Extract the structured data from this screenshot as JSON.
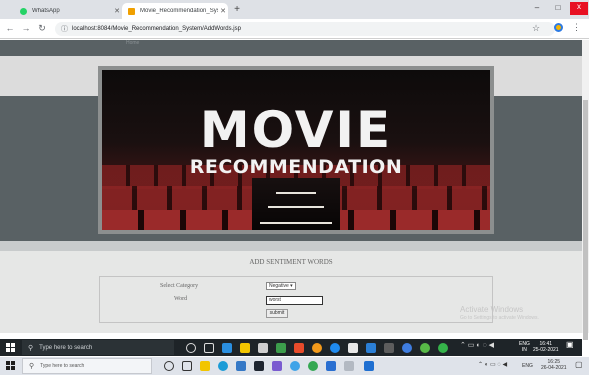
{
  "browser": {
    "tabs": [
      {
        "title": "WhatsApp",
        "fav_color": "#25d366"
      },
      {
        "title": "Movie_Recommendation_System",
        "fav_color": "#f0a000"
      }
    ],
    "new_tab": "+",
    "url": "localhost:8084/Movie_Recommendation_System/AddWords.jsp",
    "window_controls": {
      "minimize": "–",
      "maximize": "□",
      "close": "x"
    }
  },
  "page": {
    "header_text": "Home",
    "banner": {
      "title": "MOVIE",
      "subtitle": "RECOMMENDATION"
    },
    "heading": "ADD SENTIMENT WORDS",
    "form": {
      "category_label": "Select Category",
      "category_value": "Negative",
      "word_label": "Word",
      "word_value": "worst",
      "submit_label": "submit"
    },
    "watermark": {
      "line1": "Activate Windows",
      "line2": "Go to Settings to activate Windows."
    }
  },
  "taskbar_inner": {
    "search_placeholder": "Type here to search",
    "lang": "ENG",
    "region": "IN",
    "time": "16:41",
    "date": "25-02-2021"
  },
  "taskbar_outer": {
    "search_placeholder": "Type here to search",
    "lang": "ENG",
    "time": "16:25",
    "date": "26-04-2021"
  }
}
